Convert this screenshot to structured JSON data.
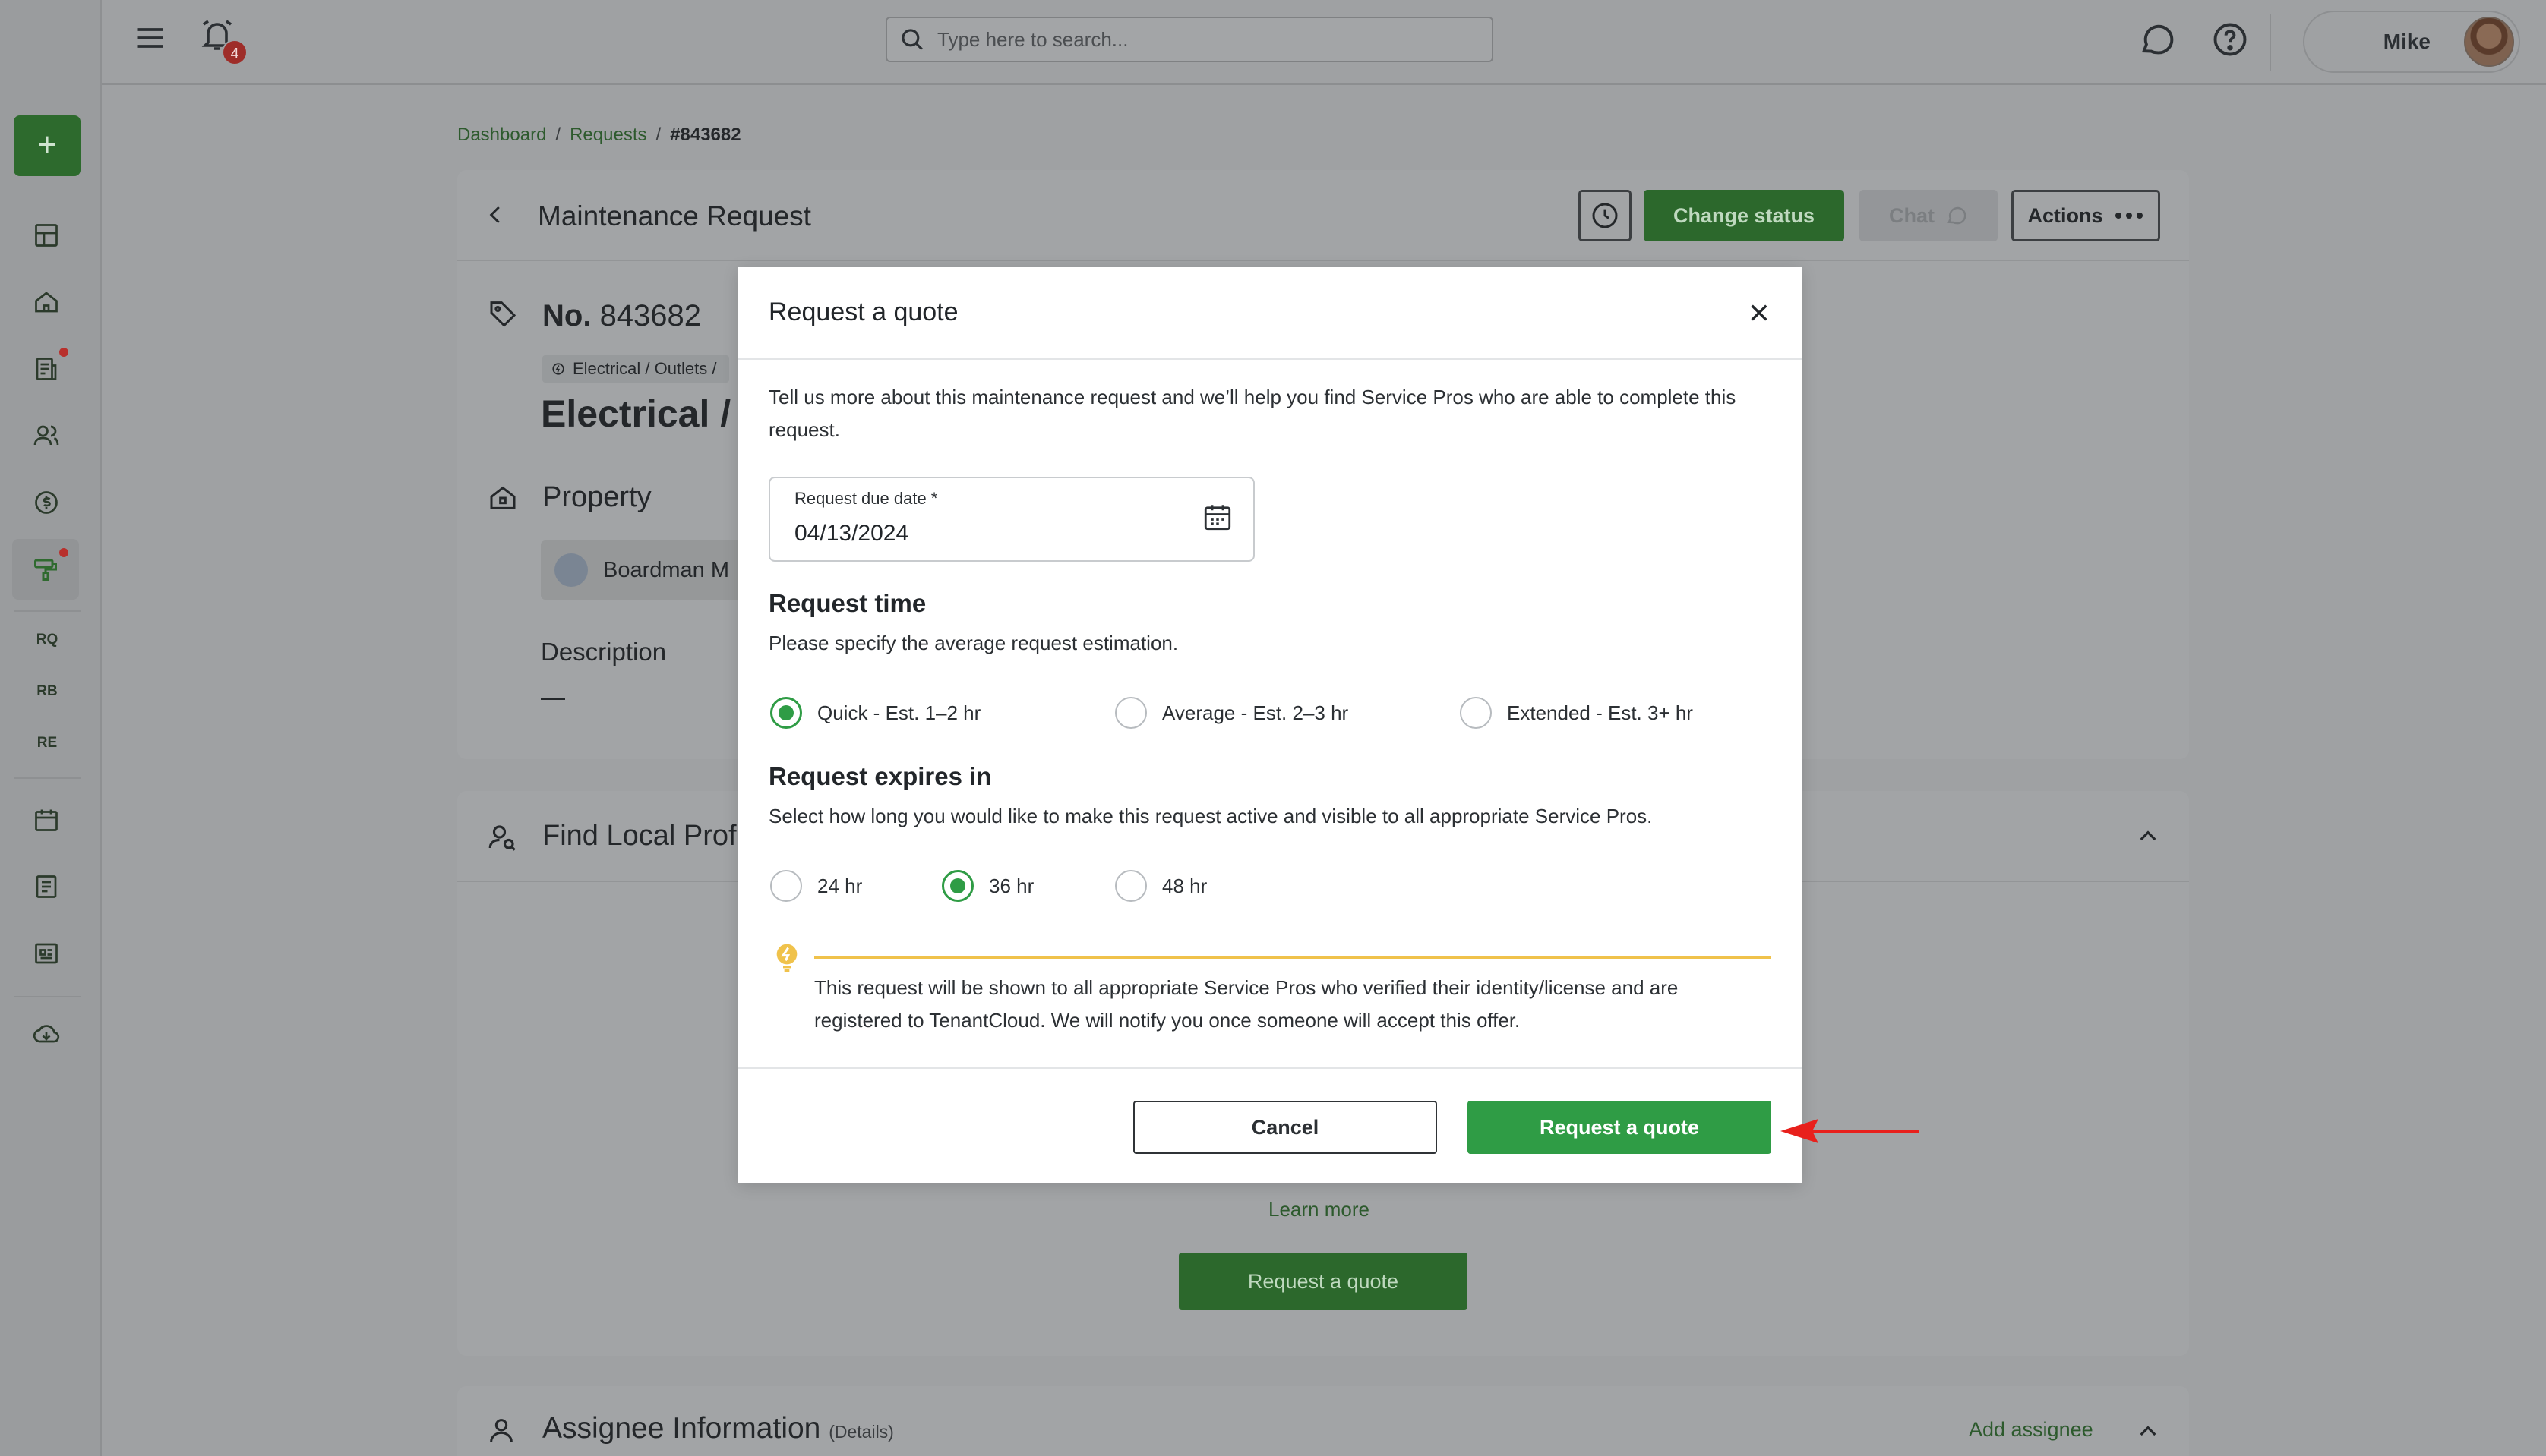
{
  "topbar": {
    "notification_count": "4",
    "search_placeholder": "Type here to search...",
    "user_name": "Mike"
  },
  "sidebar": {
    "add_label": "+",
    "text_items": [
      "RQ",
      "RB",
      "RE"
    ]
  },
  "breadcrumb": {
    "items": [
      "Dashboard",
      "Requests",
      "#843682"
    ],
    "separator": "/"
  },
  "request_card": {
    "title": "Maintenance Request",
    "buttons": {
      "change_status": "Change status",
      "chat": "Chat",
      "actions": "Actions"
    },
    "number_label": "No.",
    "number": "843682",
    "category_chip": "Electrical / Outlets /",
    "category_title": "Electrical / C",
    "property_heading": "Property",
    "property_name": "Boardman M",
    "description_heading": "Description",
    "description_value": "—"
  },
  "find_card": {
    "title": "Find Local Prof",
    "learn_more": "Learn more",
    "request_button": "Request a quote"
  },
  "assignee_card": {
    "title": "Assignee Information",
    "details": "(Details)",
    "add_assignee": "Add assignee"
  },
  "modal": {
    "title": "Request a quote",
    "intro": "Tell us more about this maintenance request and we’ll help you find Service Pros who are able to complete this request.",
    "due_date": {
      "label": "Request due date *",
      "value": "04/13/2024"
    },
    "request_time": {
      "heading": "Request time",
      "subtitle": "Please specify the average request estimation.",
      "options": [
        {
          "label": "Quick - Est. 1–2 hr",
          "selected": true
        },
        {
          "label": "Average - Est. 2–3 hr",
          "selected": false
        },
        {
          "label": "Extended - Est. 3+ hr",
          "selected": false
        }
      ]
    },
    "expires": {
      "heading": "Request expires in",
      "subtitle": "Select how long you would like to make this request active and visible to all appropriate Service Pros.",
      "options": [
        {
          "label": "24 hr",
          "selected": false
        },
        {
          "label": "36 hr",
          "selected": true
        },
        {
          "label": "48 hr",
          "selected": false
        }
      ]
    },
    "note": "This request will be shown to all appropriate Service Pros who verified their identity/license and are registered to TenantCloud. We will notify you once someone will accept this offer.",
    "cancel_label": "Cancel",
    "submit_label": "Request a quote"
  },
  "colors": {
    "accent_green": "#2f9c45",
    "dark_green": "#2c682c",
    "note_yellow": "#f0c24b",
    "annotation_arrow": "#e8201c",
    "badge_red": "#9e2d29"
  }
}
